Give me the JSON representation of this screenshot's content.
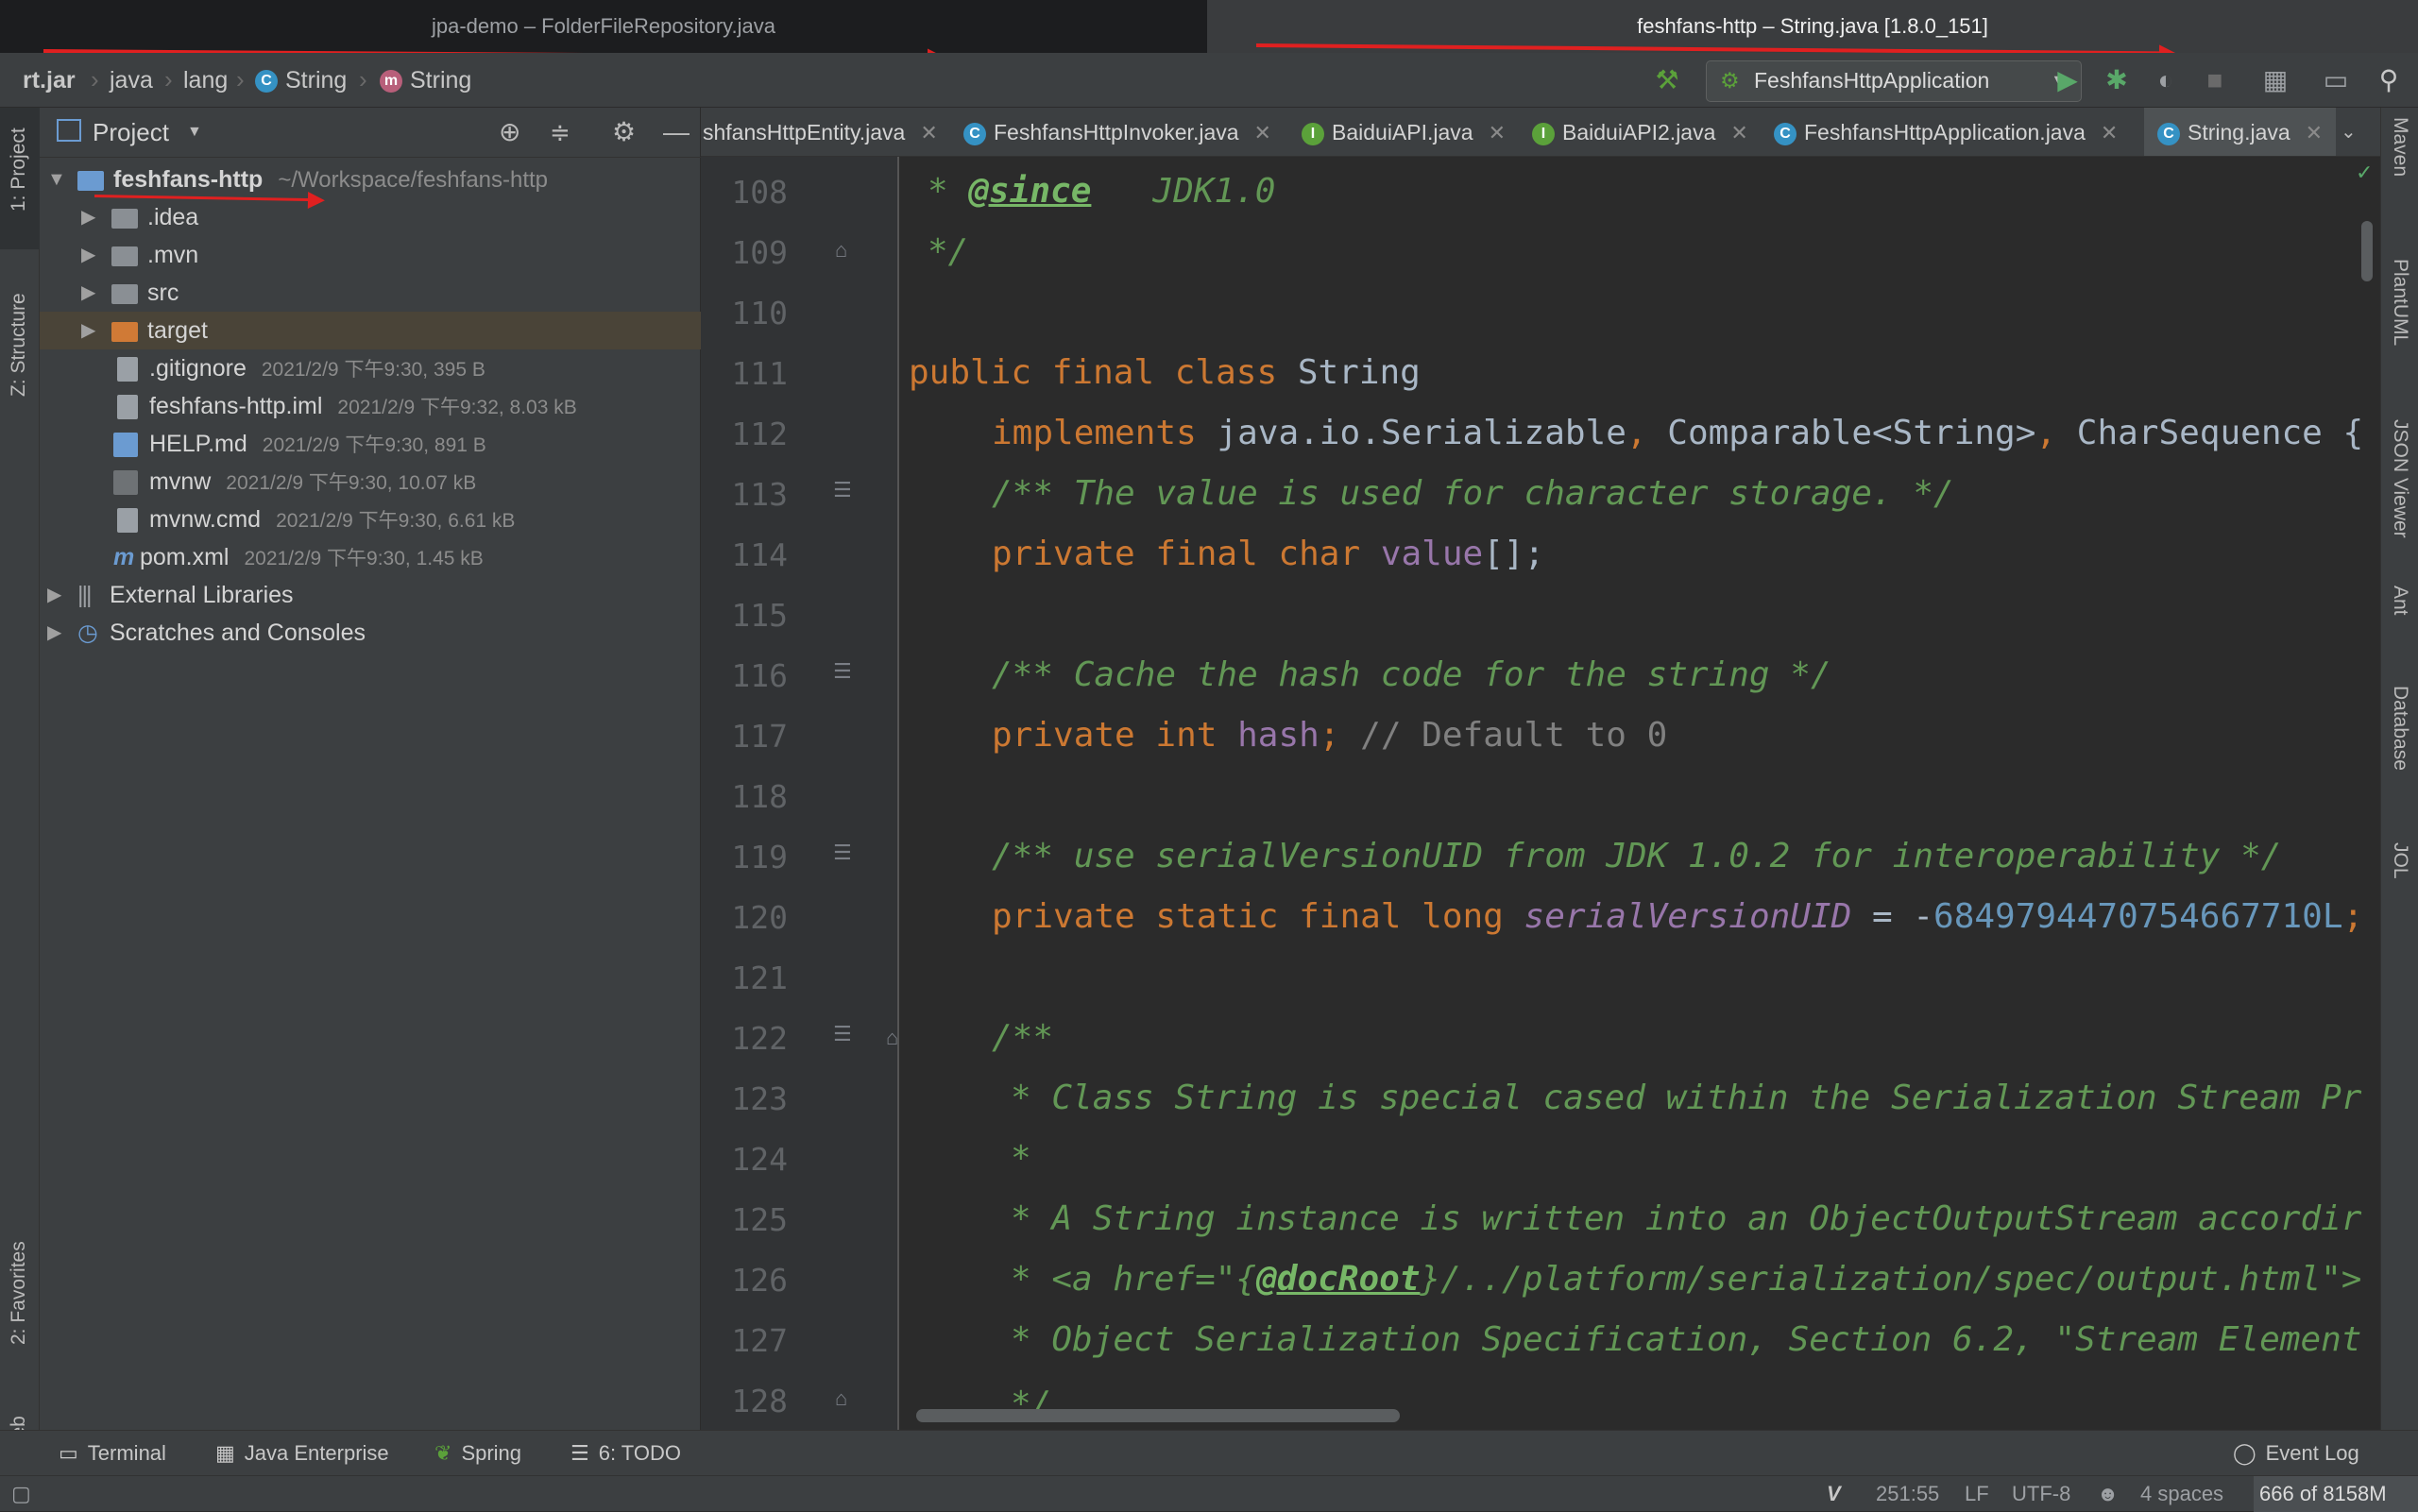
{
  "window_tabs": [
    {
      "label": "jpa-demo – FolderFileRepository.java"
    },
    {
      "label": "feshfans-http – String.java [1.8.0_151]"
    }
  ],
  "breadcrumb": [
    "rt.jar",
    "java",
    "lang",
    "String",
    "String"
  ],
  "run_config": "FeshfansHttpApplication",
  "left_stripe": {
    "project": "1: Project",
    "structure": "Z: Structure",
    "favorites": "2: Favorites",
    "web": "Web"
  },
  "project_panel": {
    "title": "Project",
    "root": {
      "name": "feshfans-http",
      "path": "~/Workspace/feshfans-http"
    },
    "items": [
      {
        "name": ".idea",
        "meta": ""
      },
      {
        "name": ".mvn",
        "meta": ""
      },
      {
        "name": "src",
        "meta": ""
      },
      {
        "name": "target",
        "meta": ""
      },
      {
        "name": ".gitignore",
        "meta": "2021/2/9 下午9:30, 395 B"
      },
      {
        "name": "feshfans-http.iml",
        "meta": "2021/2/9 下午9:32, 8.03 kB"
      },
      {
        "name": "HELP.md",
        "meta": "2021/2/9 下午9:30, 891 B"
      },
      {
        "name": "mvnw",
        "meta": "2021/2/9 下午9:30, 10.07 kB"
      },
      {
        "name": "mvnw.cmd",
        "meta": "2021/2/9 下午9:30, 6.61 kB"
      },
      {
        "name": "pom.xml",
        "meta": "2021/2/9 下午9:30, 1.45 kB"
      }
    ],
    "external_libraries": "External Libraries",
    "scratches": "Scratches and Consoles"
  },
  "editor_tabs": [
    {
      "label": "shfansHttpEntity.java"
    },
    {
      "label": "FeshfansHttpInvoker.java"
    },
    {
      "label": "BaiduiAPI.java"
    },
    {
      "label": "BaiduiAPI2.java"
    },
    {
      "label": "FeshfansHttpApplication.java"
    },
    {
      "label": "String.java"
    }
  ],
  "right_stripe": [
    "Maven",
    "PlantUML",
    "JSON Viewer",
    "Ant",
    "Database",
    "JOL"
  ],
  "code": {
    "l108": {
      "num": "108",
      "a": "* ",
      "b": "@since",
      "c": "   JDK1.0"
    },
    "l109": {
      "num": "109",
      "a": "*/"
    },
    "l110": {
      "num": "110"
    },
    "l111": {
      "num": "111",
      "a": "public final class ",
      "b": "String"
    },
    "l112": {
      "num": "112",
      "a": "implements ",
      "b": "java.io.Serializable",
      "c": ", ",
      "d": "Comparable<String>",
      "e": ", ",
      "f": "CharSequence {"
    },
    "l113": {
      "num": "113",
      "a": "/** The value is used for character storage. */"
    },
    "l114": {
      "num": "114",
      "a": "private final char ",
      "b": "value",
      "c": "[];"
    },
    "l115": {
      "num": "115"
    },
    "l116": {
      "num": "116",
      "a": "/** Cache the hash code for the string */"
    },
    "l117": {
      "num": "117",
      "a": "private int ",
      "b": "hash",
      "c": "; ",
      "d": "// Default to 0"
    },
    "l118": {
      "num": "118"
    },
    "l119": {
      "num": "119",
      "a": "/** use serialVersionUID from JDK 1.0.2 for interoperability */"
    },
    "l120": {
      "num": "120",
      "a": "private static final long ",
      "b": "serialVersionUID",
      "c": " = -",
      "d": "6849794470754667710L",
      "e": ";"
    },
    "l121": {
      "num": "121"
    },
    "l122": {
      "num": "122",
      "a": "/**"
    },
    "l123": {
      "num": "123",
      "a": "* Class String is special cased within the Serialization Stream Pr"
    },
    "l124": {
      "num": "124",
      "a": "*"
    },
    "l125": {
      "num": "125",
      "a": "* A String instance is written into an ObjectOutputStream accordir"
    },
    "l126": {
      "num": "126",
      "a": "* <a href=\"{",
      "b": "@docRoot",
      "c": "}/../platform/serialization/spec/output.html\">"
    },
    "l127": {
      "num": "127",
      "a": "* Object Serialization Specification, Section 6.2, \"Stream Element"
    },
    "l128": {
      "num": "128",
      "a": "*/"
    }
  },
  "bottom_tools": {
    "terminal": "Terminal",
    "java_enterprise": "Java Enterprise",
    "spring": "Spring",
    "todo": "6: TODO",
    "event_log": "Event Log"
  },
  "status": {
    "position": "251:55",
    "line_sep": "LF",
    "encoding": "UTF-8",
    "indent": "4 spaces",
    "memory": "666 of 8158M"
  },
  "colors": {
    "keyword": "#cc7832",
    "comment": "#629755",
    "field": "#9876aa",
    "number": "#6897bb",
    "annotation_arrow": "#e02020"
  }
}
